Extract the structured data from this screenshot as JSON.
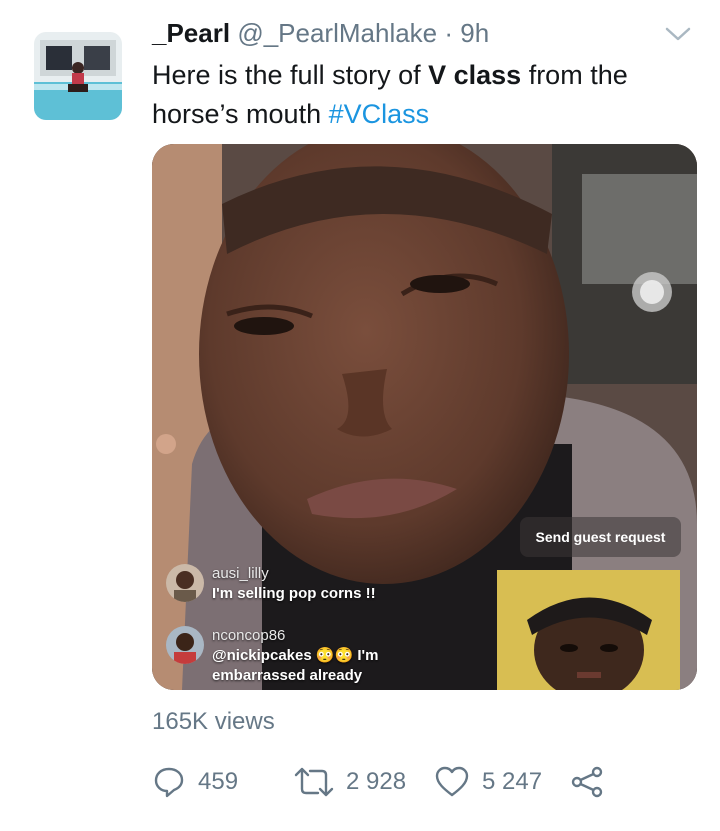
{
  "tweet": {
    "author_name": "_Pearl",
    "author_handle": "@_PearlMahlake",
    "separator": "·",
    "time": "9h",
    "text_before": "Here is the full story of ",
    "text_bold": "V class",
    "text_after": " from the horse’s mouth ",
    "hashtag": "#VClass"
  },
  "video": {
    "guest_request_label": "Send guest request",
    "comments": [
      {
        "user": "ausi_lilly",
        "message": "I'm selling pop corns !!"
      },
      {
        "user": "nconcop86",
        "message_line1": "@nickipcakes",
        "emoji": "😳😳",
        "message_line1_end": "I'm",
        "message_line2": "embarrassed already"
      }
    ]
  },
  "stats": {
    "views": "165K views",
    "replies": "459",
    "retweets": "2 928",
    "likes": "5 247"
  },
  "icons": {
    "reply": "reply-icon",
    "retweet": "retweet-icon",
    "like": "heart-icon",
    "share": "share-icon",
    "menu": "chevron-down-icon"
  },
  "colors": {
    "link": "#1b95e0",
    "secondary_text": "#657786"
  }
}
